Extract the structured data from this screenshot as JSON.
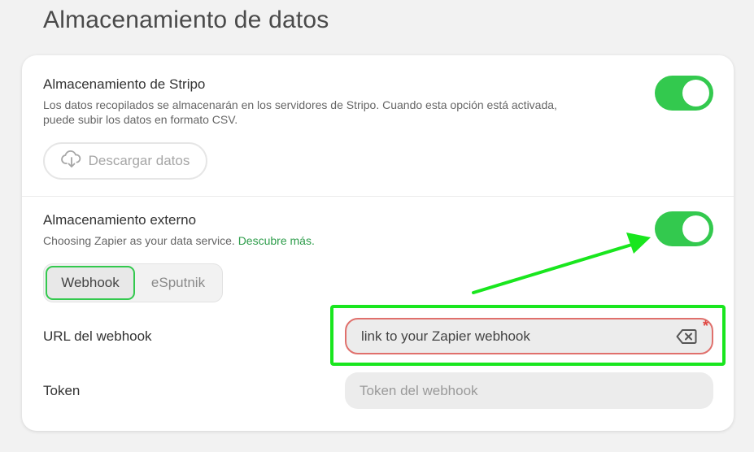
{
  "page": {
    "title": "Almacenamiento de datos"
  },
  "stripo_storage": {
    "title": "Almacenamiento de Stripo",
    "description_line1": "Los datos recopilados se almacenarán en los servidores de Stripo. Cuando esta opción está activada,",
    "description_line2": "puede subir los datos en formato CSV.",
    "enabled": true,
    "download_label": "Descargar datos",
    "download_icon": "cloud-download-icon"
  },
  "external_storage": {
    "title": "Almacenamiento externo",
    "description": "Choosing Zapier as your data service.",
    "learn_more": "Descubre más.",
    "enabled": true,
    "tabs": [
      {
        "label": "Webhook",
        "active": true
      },
      {
        "label": "eSputnik",
        "active": false
      }
    ],
    "webhook_url_label": "URL del webhook",
    "webhook_url_value": "link to your Zapier webhook",
    "required_mark": "*",
    "token_label": "Token",
    "token_placeholder": "Token del webhook"
  },
  "colors": {
    "toggle_on": "#33c94e",
    "link": "#2e9d4b",
    "error_border": "#e0706c",
    "annotation": "#19e61e"
  }
}
